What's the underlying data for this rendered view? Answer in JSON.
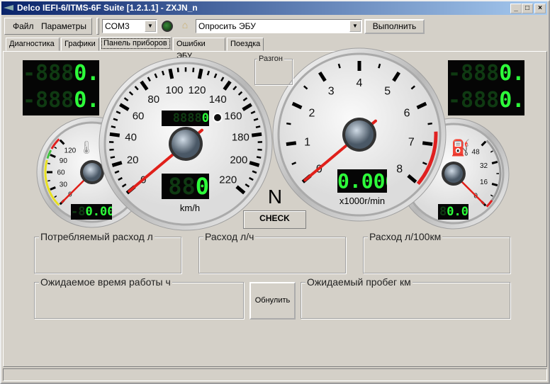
{
  "window": {
    "title": "Delco IEFI-6/ITMS-6F Suite [1.2.1.1] - ZXJN_n",
    "controls": [
      "_",
      "□",
      "×"
    ]
  },
  "menu": {
    "items": [
      "Файл",
      "Параметры"
    ]
  },
  "toolbar": {
    "port": "COM3",
    "command": "Опросить ЭБУ",
    "execute_label": "Выполнить",
    "led_color": "#1a5a1a"
  },
  "tabs": [
    {
      "label": "Диагностика"
    },
    {
      "label": "Графики"
    },
    {
      "label": "Панель приборов",
      "active": true
    },
    {
      "label": "Ошибки ЭБУ"
    },
    {
      "label": "Поездка"
    }
  ],
  "dashboard": {
    "lcd_left": [
      {
        "dim": "-888",
        "value": "0.00"
      },
      {
        "dim": "-888",
        "value": "0.00"
      }
    ],
    "lcd_right": [
      {
        "dim": "-888",
        "value": "0.00"
      },
      {
        "dim": "-888",
        "value": "0.00"
      }
    ],
    "speedometer": {
      "labels": [
        "0",
        "20",
        "40",
        "60",
        "80",
        "100",
        "120",
        "140",
        "160",
        "180",
        "200",
        "220"
      ],
      "min": 0,
      "max": 220,
      "value": 0,
      "unit": "km/h",
      "odometer_dim": "8888",
      "odometer_value": "0",
      "speed_dim": "88",
      "speed_value": "0"
    },
    "tachometer": {
      "labels": [
        "0",
        "1",
        "2",
        "3",
        "4",
        "5",
        "6",
        "7",
        "8"
      ],
      "min": 0,
      "max": 8,
      "value": 0,
      "redline": 6.7,
      "unit": "x1000r/min",
      "display": "0.000"
    },
    "temperature": {
      "labels": [
        "0",
        "30",
        "60",
        "90",
        "120"
      ],
      "min": 0,
      "max": 120,
      "value": 0,
      "display_dim": "-8",
      "display": "0.00",
      "icon": "coolant-temperature-icon"
    },
    "fuel": {
      "labels": [
        "0",
        "16",
        "32",
        "48"
      ],
      "min": 0,
      "max": 48,
      "value": 0,
      "display_dim": "8",
      "display": "0.0",
      "icon": "fuel-pump-icon"
    },
    "gear": "N",
    "check_label": "CHECK",
    "acceleration_label": "Разгон"
  },
  "readouts": {
    "consumed": "Потребляемый расход л",
    "rate_lph": "Расход л/ч",
    "rate_l100": "Расход л/100км",
    "time_left": "Ожидаемое время работы ч",
    "reset_label": "Обнулить",
    "range_left": "Ожидаемый пробег км"
  }
}
